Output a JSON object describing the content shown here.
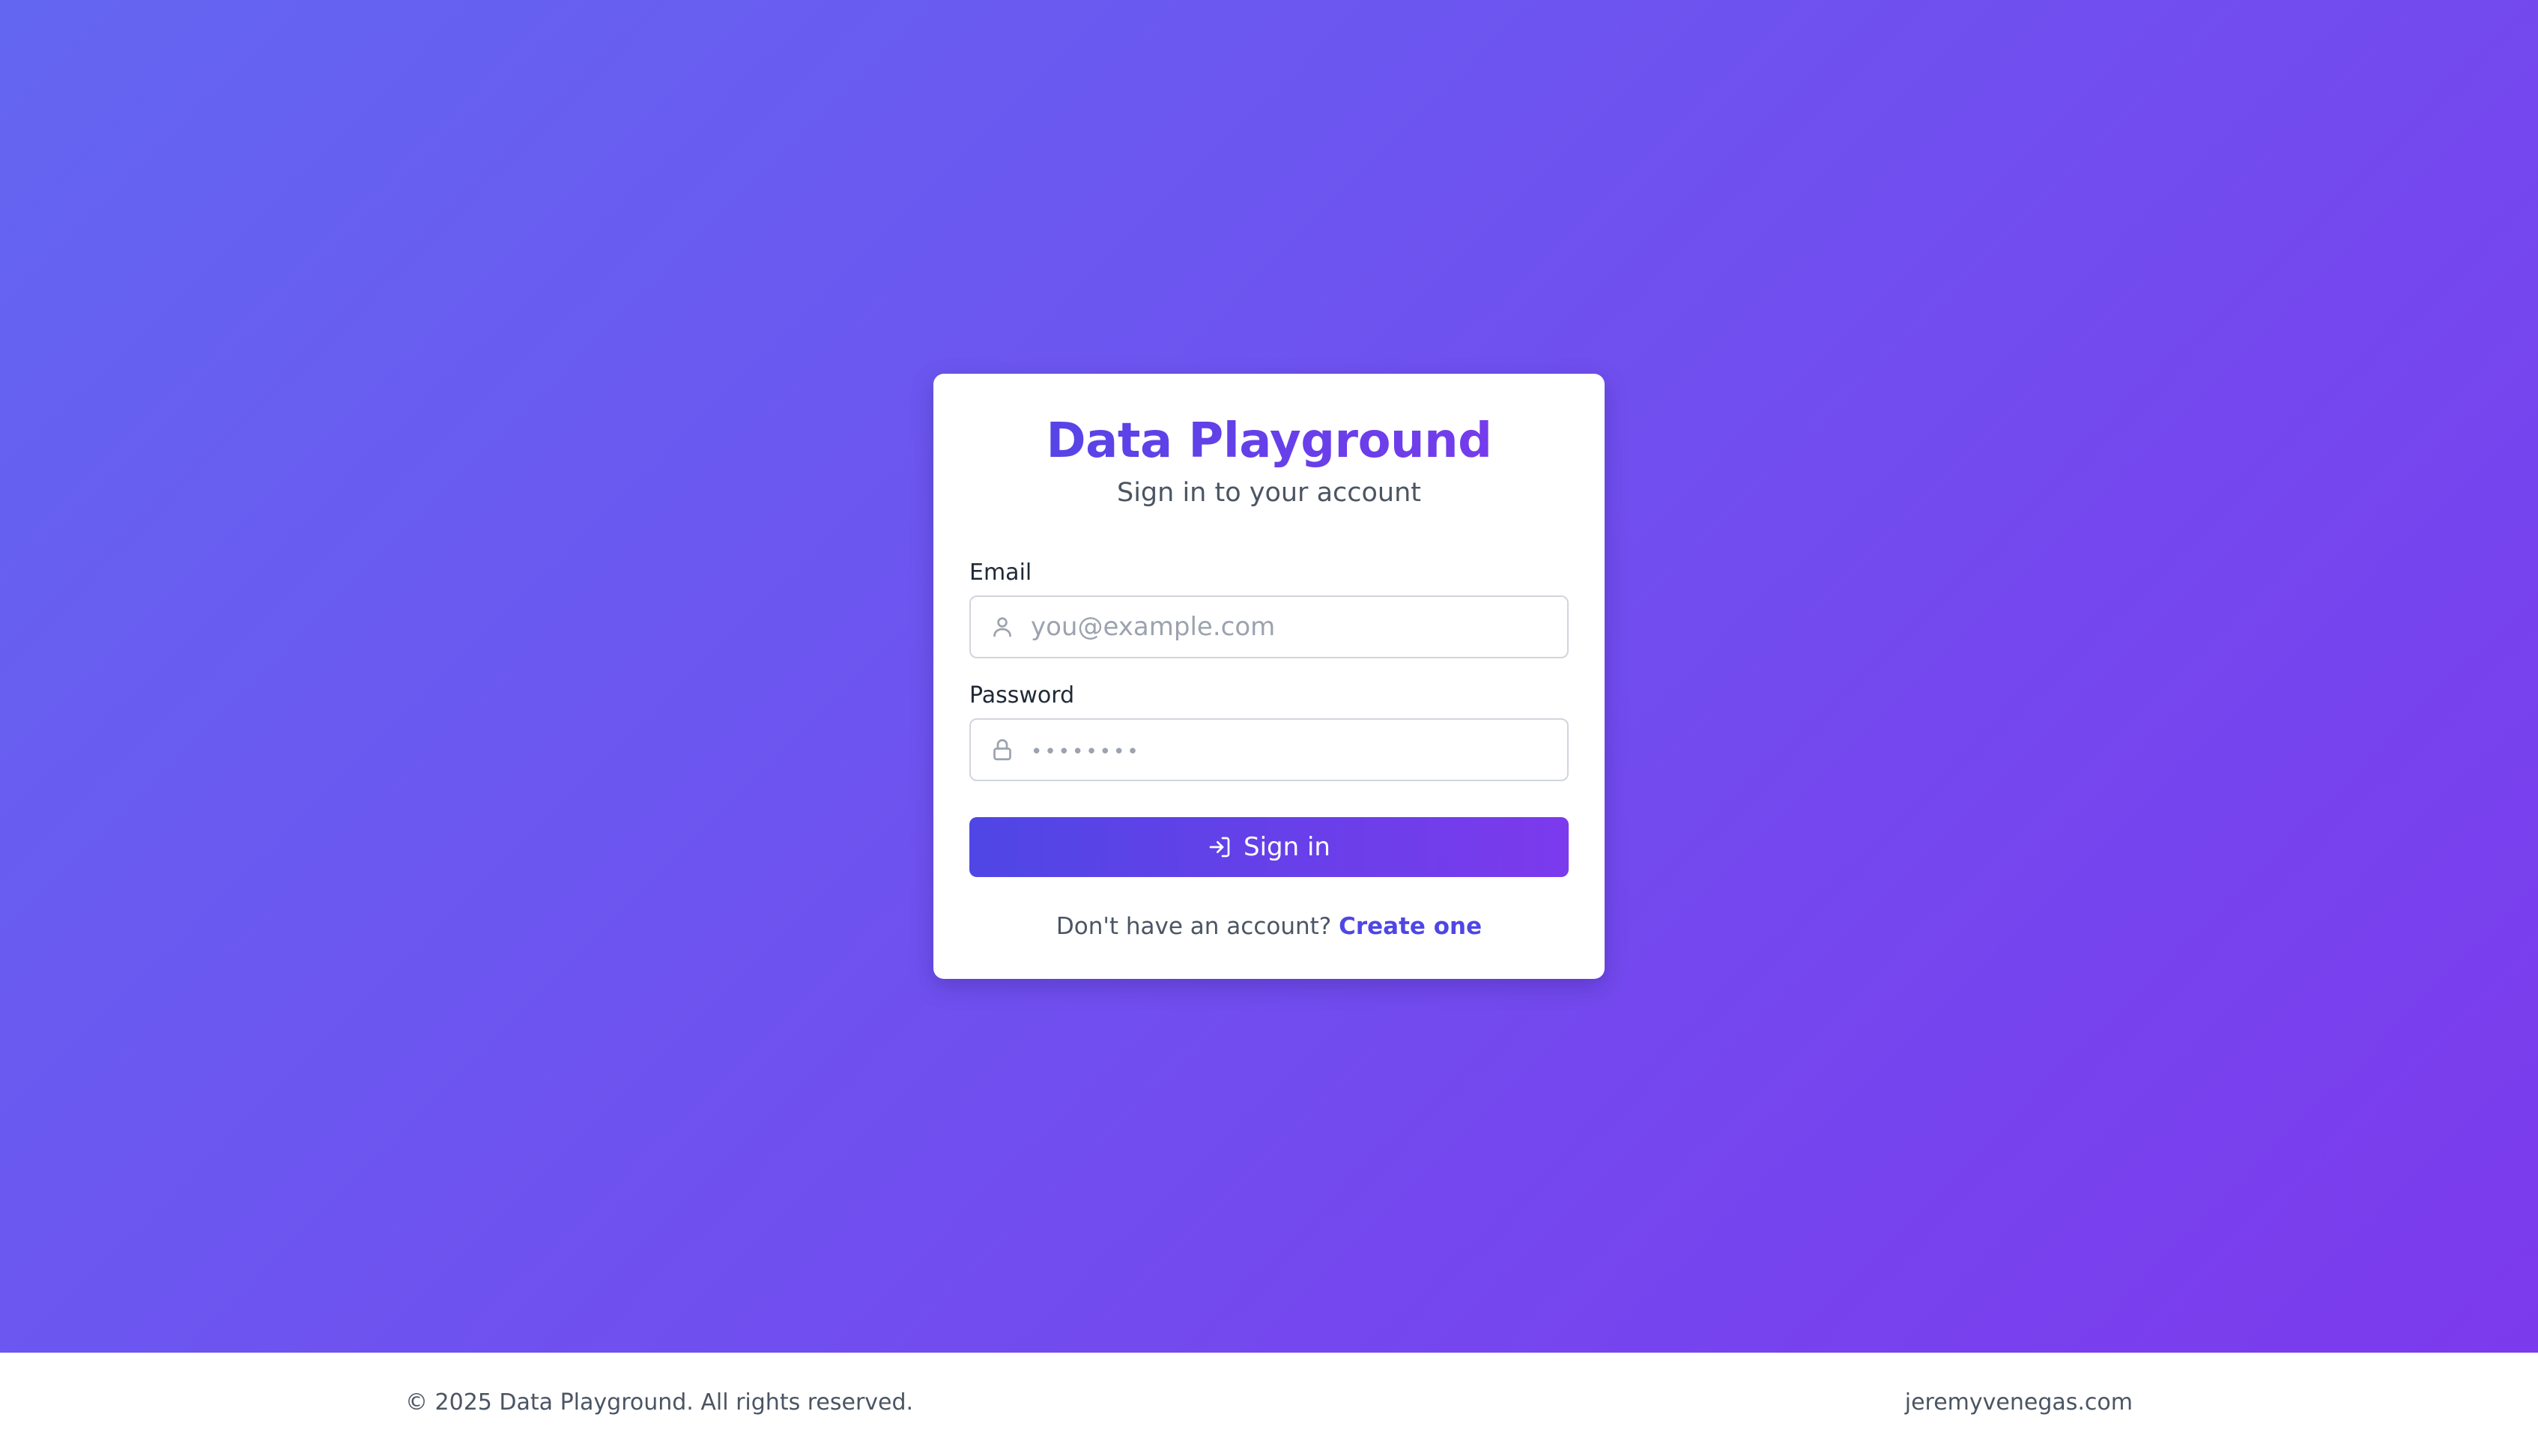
{
  "card": {
    "title": "Data Playground",
    "subtitle": "Sign in to your account",
    "email": {
      "label": "Email",
      "placeholder": "you@example.com",
      "value": "",
      "icon": "user-icon"
    },
    "password": {
      "label": "Password",
      "placeholder": "••••••••",
      "value": "",
      "icon": "lock-icon"
    },
    "submit": {
      "label": "Sign in",
      "icon": "login-icon"
    },
    "signup": {
      "prompt": "Don't have an account?",
      "link_label": "Create one"
    }
  },
  "footer": {
    "copyright": "© 2025 Data Playground. All rights reserved.",
    "site": "jeremyvenegas.com"
  },
  "colors": {
    "gradient_start": "#6366f1",
    "gradient_end": "#7c3aed",
    "accent": "#4f46e5"
  }
}
